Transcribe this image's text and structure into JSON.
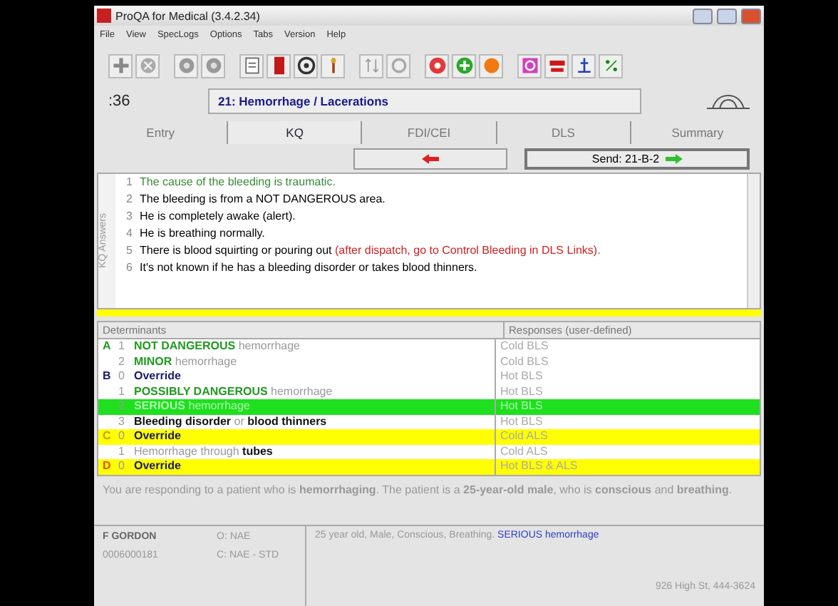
{
  "window": {
    "title": "ProQA for Medical (3.4.2.34)"
  },
  "menu": [
    "File",
    "View",
    "SpecLogs",
    "Options",
    "Tabs",
    "Version",
    "Help"
  ],
  "header": {
    "timer": ":36",
    "protocol": "21: Hemorrhage / Lacerations"
  },
  "tabs": [
    {
      "label": "Entry",
      "selected": false
    },
    {
      "label": "KQ",
      "selected": true
    },
    {
      "label": "FDI/CEI",
      "selected": false
    },
    {
      "label": "DLS",
      "selected": false
    },
    {
      "label": "Summary",
      "selected": false
    }
  ],
  "send_button": "Send: 21-B-2",
  "answers_label": "KQ Answers",
  "answers": [
    {
      "number": "1",
      "text": "The cause of the bleeding is traumatic.",
      "color": "#3a8a3a"
    },
    {
      "number": "2",
      "text": "The bleeding is from a NOT DANGEROUS area.",
      "color": "#000000"
    },
    {
      "number": "3",
      "text": "He is completely awake (alert).",
      "color": "#000000"
    },
    {
      "number": "4",
      "text": "He is breathing normally.",
      "color": "#000000"
    },
    {
      "number": "5",
      "text": "There is blood squirting or pouring out",
      "note": "(after dispatch, go to Control Bleeding in DLS Links).",
      "color": "#000000"
    },
    {
      "number": "6",
      "text": "It's not known if he has a bleeding disorder or takes blood thinners.",
      "color": "#000000"
    }
  ],
  "table": {
    "columns": [
      "Determinants",
      "Responses (user-defined)"
    ],
    "rows": [
      {
        "level": {
          "code": "A",
          "color": "#1f9a1f"
        },
        "number": "1",
        "text": "**NOT DANGEROUS** hemorrhage",
        "response": "Cold BLS",
        "color": "#1f9a1f",
        "selected": false,
        "highlight": false
      },
      {
        "number": "2",
        "text": "**MINOR** hemorrhage",
        "response": "Cold BLS",
        "color": "#1f9a1f",
        "selected": false,
        "highlight": false
      },
      {
        "level": {
          "code": "B",
          "color": "#1a1a6e"
        },
        "number": "0",
        "text": "Override",
        "emphasis": true,
        "response": "Hot BLS",
        "color": "#1a1a6e",
        "selected": false,
        "highlight": false
      },
      {
        "number": "1",
        "text": "**POSSIBLY DANGEROUS** hemorrhage",
        "response": "Hot BLS",
        "color": "#1f9a1f",
        "selected": false,
        "highlight": false
      },
      {
        "number": "2",
        "text": "**SERIOUS** hemorrhage",
        "response": "Hot BLS",
        "selected": true,
        "highlight": false
      },
      {
        "number": "3",
        "text": "**Bleeding disorder** or **blood thinners**",
        "response": "Hot BLS",
        "color": "#111111",
        "selected": false,
        "highlight": false
      },
      {
        "level": {
          "code": "C",
          "color": "#c8a000"
        },
        "number": "0",
        "text": "Override",
        "emphasis": true,
        "response": "Cold ALS",
        "selected": false,
        "highlight": true
      },
      {
        "number": "1",
        "text": "Hemorrhage through **tubes**",
        "response": "Cold ALS",
        "color": "#111111",
        "selected": false,
        "highlight": false
      },
      {
        "level": {
          "code": "D",
          "color": "#e05000"
        },
        "number": "0",
        "text": "Override",
        "emphasis": true,
        "response": "Hot BLS & ALS",
        "selected": false,
        "highlight": true
      }
    ]
  },
  "summary": "You are responding to a patient who is **hemorrhaging**.  The patient is a **25-year-old male**, who is **conscious** and **breathing**.",
  "status_bar": {
    "caller": "F GORDON",
    "number": "0006000181",
    "origin": "O: NAE",
    "code": "C: NAE - STD",
    "description": "25 year old, Male, Conscious, Breathing.",
    "determinant": "SERIOUS hemorrhage",
    "address": "926 High St,  444-3624"
  }
}
